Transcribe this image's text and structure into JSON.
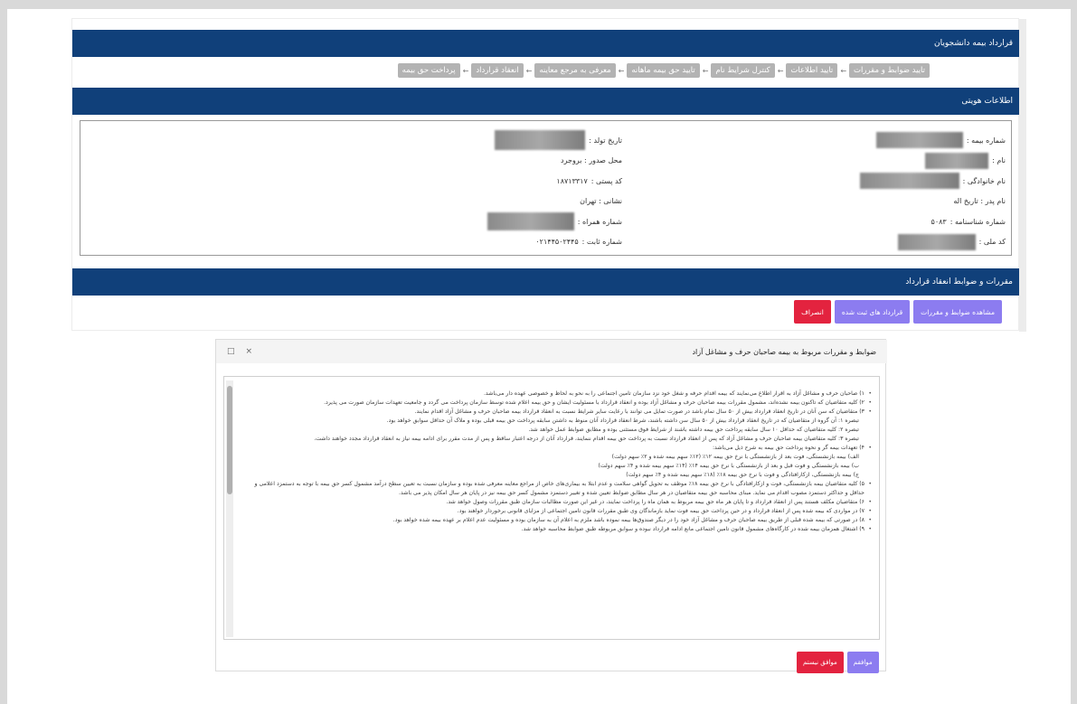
{
  "panel": {
    "title": "قرارداد بیمه دانشجویان",
    "steps": [
      "تایید ضوابط و مقررات",
      "تایید اطلاعات",
      "کنترل شرایط نام",
      "تایید حق بیمه ماهانه",
      "معرفی به مرجع معاینه",
      "انعقاد قرارداد",
      "پرداخت حق بیمه"
    ],
    "arrow": "←",
    "identity": {
      "title": "اطلاعات هویتی",
      "right_column": [
        {
          "label": "شماره بیمه :",
          "value": ""
        },
        {
          "label": "نام :",
          "value": ""
        },
        {
          "label": "نام خانوادگی :",
          "value": ""
        },
        {
          "label": "نام پدر : تاریخ اله",
          "value": ""
        },
        {
          "label": "شماره شناسنامه :",
          "value": "۵۰۸۳"
        },
        {
          "label": "کد ملی :",
          "value": ""
        }
      ],
      "middle_column": [
        {
          "label": "تاریخ تولد :",
          "value": ""
        },
        {
          "label": "محل صدور : بروجرد",
          "value": ""
        },
        {
          "label": "کد پستی :",
          "value": "۱۸۷۱۳۳۱۷"
        },
        {
          "label": "نشانی : تهران",
          "value": ""
        },
        {
          "label": "شماره همراه :",
          "value": ""
        },
        {
          "label": "شماره ثابت :",
          "value": "۰۲۱۴۴۵۰۲۴۴۵"
        }
      ]
    },
    "contract": {
      "title": "مقررات و ضوابط انعقاد قرارداد",
      "buttons": [
        "مشاهده ضوابط و مقررات",
        "قرارداد های ثبت شده",
        "انصراف"
      ]
    }
  },
  "modal": {
    "title": "ضوابط و مقررات مربوط به بیمه صاحبان حرف و مشاغل آزاد",
    "controls": [
      "×",
      "□"
    ],
    "terms": [
      {
        "text": "۱) صاحبان حرف و مشاغل آزاد به اقرار اطلاع می‌نمایند که بیمه اقدام حرفه و شغل خود نزد سازمان تامین اجتماعی را به نحو به لحاظ و خصوصی عهده دار می‌باشد.",
        "sub": false
      },
      {
        "text": "۲) کلیه متقاضیان که تاکنون بیمه نشده‌اند، مشمول مقررات بیمه صاحبان حرف و مشاغل آزاد بوده و انعقاد قرارداد با مسئولیت ایشان و حق بیمه اعلام شده توسط سازمان پرداخت می گردد و جامعیت تعهدات سازمان صورت می پذیرد.",
        "sub": false
      },
      {
        "text": "۳) متقاضیان که سن آنان در تاریخ انعقاد قرارداد بیش از ۵۰ سال تمام باشد در صورت تمایل می توانند با رعایت سایر شرایط نسبت به انعقاد قرارداد بیمه صاحبان حرف و مشاغل آزاد اقدام نمایند.",
        "sub": false
      },
      {
        "text": "تبصره ۱: آن گروه از متقاضیان که در تاریخ انعقاد قرارداد بیش از ۵۰ سال سن داشته باشند، شرط انعقاد قرارداد آنان منوط به داشتن سابقه پرداخت حق بیمه قبلی بوده و ملاک آن حداقل سوابق خواهد بود.",
        "sub": true
      },
      {
        "text": "تبصره ۲: کلیه متقاضیان که حداقل ۱۰ سال سابقه پرداخت حق بیمه داشته باشند از شرایط فوق مستثنی بوده و مطابق ضوابط عمل خواهد شد.",
        "sub": true
      },
      {
        "text": "تبصره ۳: کلیه متقاضیان بیمه صاحبان حرف و مشاغل آزاد که پس از انعقاد قرارداد نسبت به پرداخت حق بیمه اقدام ننمایند، قرارداد آنان از درجه اعتبار ساقط و پس از مدت مقرر برای ادامه بیمه نیاز به انعقاد قرارداد مجدد خواهند داشت.",
        "sub": true
      },
      {
        "text": "۴) تعهدات بیمه گر و نحوه پرداخت حق بیمه به شرح ذیل می‌باشد:",
        "sub": false
      },
      {
        "text": "الف) بیمه بازنشستگی، فوت بعد از بازنشستگی با نرخ حق بیمه ۱۲٪ (۱۲٪ سهم بیمه شده و ۲٪ سهم دولت)",
        "sub": true
      },
      {
        "text": "ب) بیمه بازنشستگی و فوت قبل و بعد از بازنشستگی با نرخ حق بیمه ۱۴٪ (۱۴٪ سهم بیمه شده و ۴٪ سهم دولت)",
        "sub": true
      },
      {
        "text": "ج) بیمه بازنشستگی، ازکارافتادگی و فوت با نرخ حق بیمه ۱۸٪ (۱۸٪ سهم بیمه شده و ۴٪ سهم دولت)",
        "sub": true
      },
      {
        "text": "۵) کلیه متقاضیان بیمه بازنشستگی، فوت و ازکارافتادگی با نرخ حق بیمه ۱۸٪ موظف به تحویل گواهی سلامت و عدم ابتلا به بیماری‌های خاص از مراجع معاینه معرفی شده بوده و سازمان نسبت به تعیین سطح درآمد مشمول کسر حق بیمه با توجه به دستمزد اعلامی و حداقل و حداکثر دستمزد مصوب اقدام می نماید. مبنای محاسبه حق بیمه متقاضیان در هر سال مطابق ضوابط تعیین شده و تغییر دستمزد مشمول کسر حق بیمه نیز در پایان هر سال امکان پذیر می باشد.",
        "sub": false
      },
      {
        "text": "۶) متقاضیان مکلف هستند پس از انعقاد قرارداد و تا پایان هر ماه حق بیمه مربوط به همان ماه را پرداخت نمایند، در غیر این صورت مطالبات سازمان طبق مقررات وصول خواهد شد.",
        "sub": false
      },
      {
        "text": "۷) در مواردی که بیمه شده پس از انعقاد قرارداد و در حین پرداخت حق بیمه فوت نماید بازماندگان وی طبق مقررات قانون تامین اجتماعی از مزایای قانونی برخوردار خواهند بود.",
        "sub": false
      },
      {
        "text": "۸) در صورتی که بیمه شده قبلی از طریق بیمه صاحبان حرف و مشاغل آزاد خود را در دیگر صندوق‌ها بیمه نموده باشد ملزم به اعلام آن به سازمان بوده و مسئولیت عدم اعلام بر عهده بیمه شده خواهد بود.",
        "sub": false
      },
      {
        "text": "۹) اشتغال همزمان بیمه شده در کارگاه‌های مشمول قانون تامین اجتماعی مانع ادامه قرارداد نبوده و سوابق مربوطه طبق ضوابط محاسبه خواهد شد.",
        "sub": false
      }
    ],
    "footer_buttons": [
      "موافقم",
      "موافق نیستم"
    ]
  },
  "colors": {
    "header_blue": "#10407a",
    "step_gray": "#b3b3b3",
    "button_purple": "#8c7cf0",
    "button_red": "#e3233f"
  }
}
